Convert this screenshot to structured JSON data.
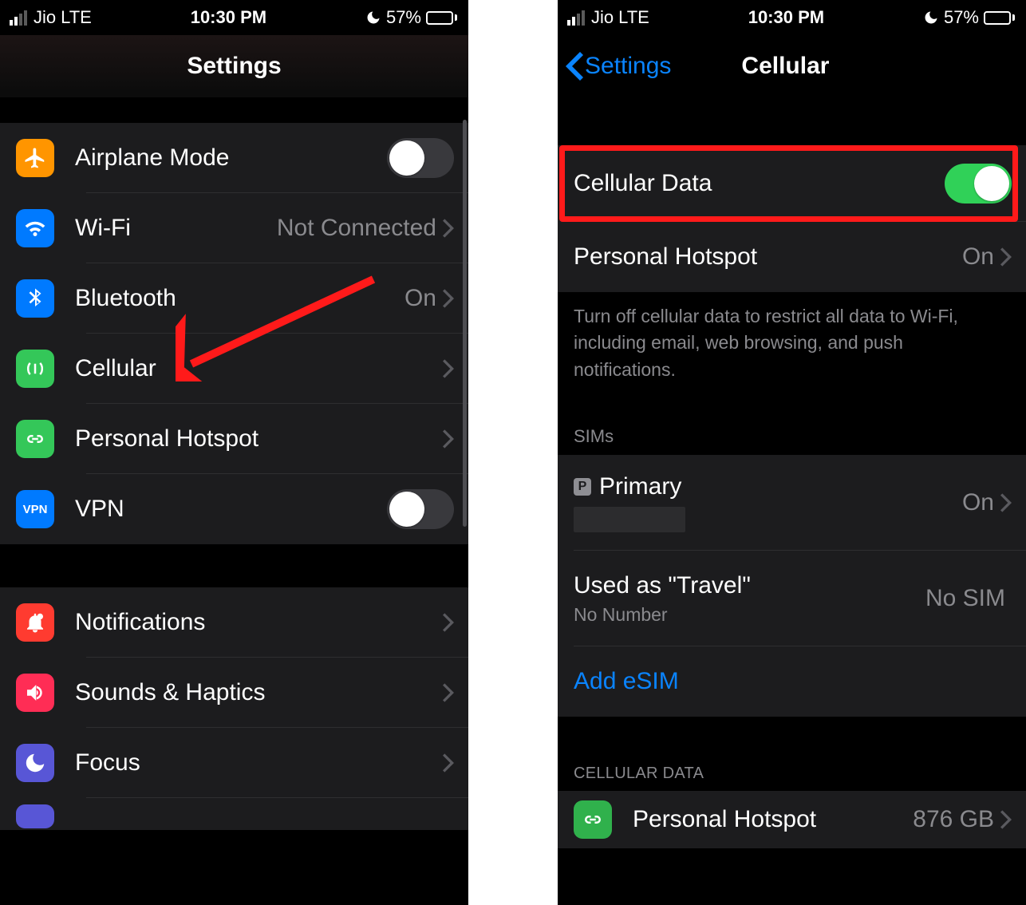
{
  "status": {
    "carrier": "Jio",
    "network": "LTE",
    "time": "10:30 PM",
    "battery_pct": "57%"
  },
  "left": {
    "title": "Settings",
    "rows": {
      "airplane": "Airplane Mode",
      "wifi": "Wi-Fi",
      "wifi_detail": "Not Connected",
      "bluetooth": "Bluetooth",
      "bluetooth_detail": "On",
      "cellular": "Cellular",
      "hotspot": "Personal Hotspot",
      "vpn": "VPN",
      "notifications": "Notifications",
      "sounds": "Sounds & Haptics",
      "focus": "Focus"
    }
  },
  "right": {
    "back": "Settings",
    "title": "Cellular",
    "cell_data": "Cellular Data",
    "hotspot": "Personal Hotspot",
    "hotspot_detail": "On",
    "footer": "Turn off cellular data to restrict all data to Wi-Fi, including email, web browsing, and push notifications.",
    "sims_header": "SIMs",
    "primary_badge": "P",
    "primary": "Primary",
    "primary_detail": "On",
    "travel_label": "Used as \"Travel\"",
    "travel_sub": "No Number",
    "travel_detail": "No SIM",
    "add_esim": "Add eSIM",
    "cell_data_header": "CELLULAR DATA",
    "hotspot2": "Personal Hotspot",
    "hotspot2_detail": "876 GB"
  }
}
